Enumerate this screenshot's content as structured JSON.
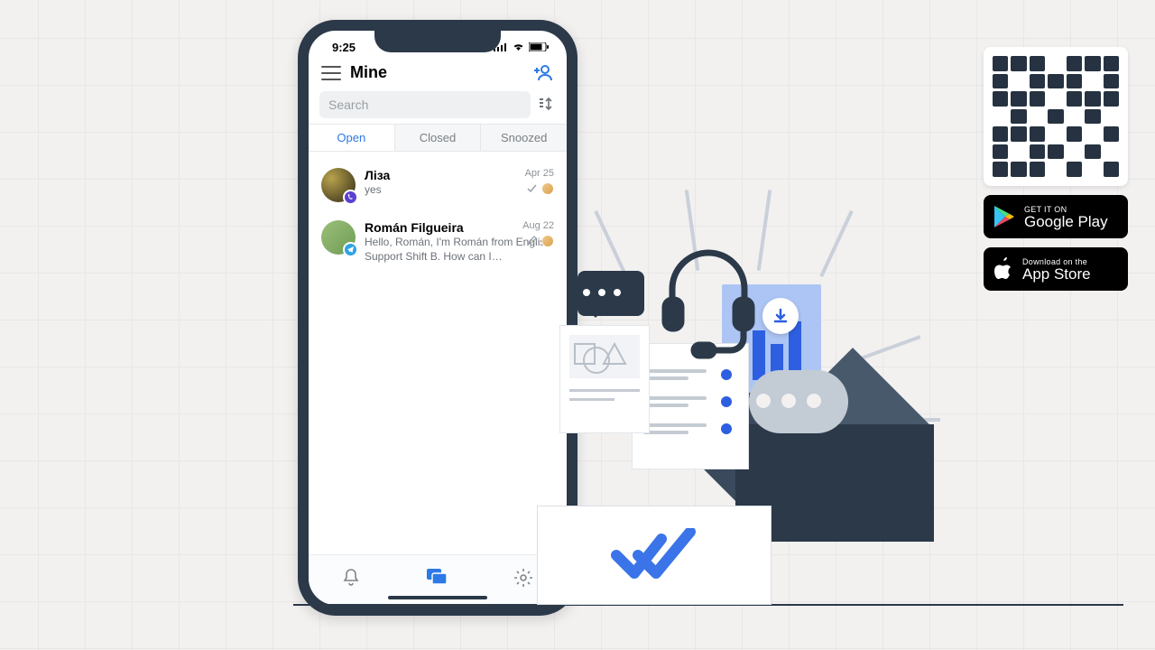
{
  "statusbar": {
    "time": "9:25"
  },
  "header": {
    "title": "Mine"
  },
  "search": {
    "placeholder": "Search"
  },
  "tabs": [
    {
      "label": "Open",
      "active": true
    },
    {
      "label": "Closed",
      "active": false
    },
    {
      "label": "Snoozed",
      "active": false
    }
  ],
  "conversations": [
    {
      "name": "Ліза",
      "preview": "yes",
      "date": "Apr 25",
      "channel": "viber"
    },
    {
      "name": "Román Filgueira",
      "preview": "Hello, Román,  I'm Román from English Support Shift B.  How can I…",
      "date": "Aug 22",
      "channel": "telegram"
    }
  ],
  "store": {
    "google": {
      "top": "GET IT ON",
      "bottom": "Google Play"
    },
    "apple": {
      "top": "Download on the",
      "bottom": "App Store"
    }
  }
}
